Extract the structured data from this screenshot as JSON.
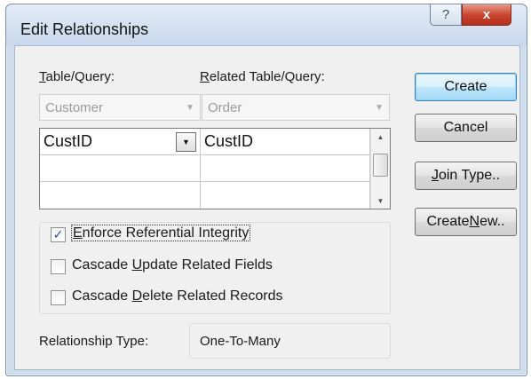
{
  "window": {
    "title": "Edit Relationships",
    "help_glyph": "?",
    "close_glyph": "x"
  },
  "table_query": {
    "label_pre": "",
    "label_accel": "T",
    "label_post": "able/Query:",
    "value": "Customer"
  },
  "related_table_query": {
    "label_pre": "",
    "label_accel": "R",
    "label_post": "elated Table/Query:",
    "value": "Order"
  },
  "field_grid": {
    "rows": [
      {
        "left": "CustID",
        "right": "CustID"
      },
      {
        "left": "",
        "right": ""
      },
      {
        "left": "",
        "right": ""
      }
    ]
  },
  "options": {
    "enforce": {
      "pre": "",
      "accel": "E",
      "post": "nforce Referential Integrity",
      "checked": true
    },
    "cascade_update": {
      "pre": "Cascade ",
      "accel": "U",
      "post": "pdate Related Fields",
      "checked": false
    },
    "cascade_delete": {
      "pre": "Cascade ",
      "accel": "D",
      "post": "elete Related Records",
      "checked": false
    }
  },
  "relationship_type": {
    "label": "Relationship Type:",
    "value": "One-To-Many"
  },
  "buttons": {
    "create": "Create",
    "cancel": "Cancel",
    "join_type": {
      "pre": "",
      "accel": "J",
      "post": "oin Type.."
    },
    "create_new": {
      "pre": "Create ",
      "accel": "N",
      "post": "ew.."
    }
  },
  "check_glyph": "✓",
  "colors": {
    "default_button_border": "#3c7fb1",
    "close_button": "#c7412b",
    "check_mark": "#2b4d9a"
  }
}
